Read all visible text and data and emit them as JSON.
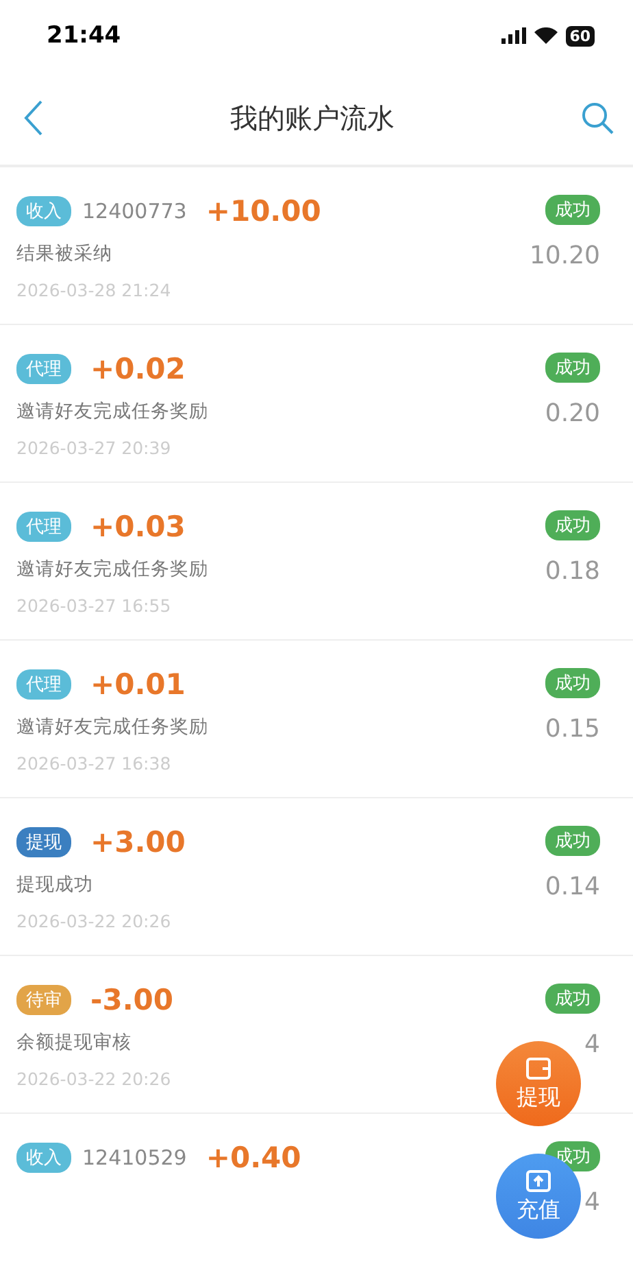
{
  "status_bar": {
    "time": "21:44",
    "battery": "60"
  },
  "nav": {
    "title": "我的账户流水"
  },
  "records": [
    {
      "tag": "收入",
      "color": "#5bbcd8",
      "order": "12400773",
      "amount": "+10.00",
      "status": "成功",
      "description": "结果被采纳",
      "balance": "10.20",
      "date": "2026-03-28 21:24"
    },
    {
      "tag": "代理",
      "color": "#5bbcd8",
      "amount": "+0.02",
      "status": "成功",
      "description": "邀请好友完成任务奖励",
      "balance": "0.20",
      "date": "2026-03-27 20:39"
    },
    {
      "tag": "代理",
      "color": "#5bbcd8",
      "amount": "+0.03",
      "status": "成功",
      "description": "邀请好友完成任务奖励",
      "balance": "0.18",
      "date": "2026-03-27 16:55"
    },
    {
      "tag": "代理",
      "color": "#5bbcd8",
      "amount": "+0.01",
      "status": "成功",
      "description": "邀请好友完成任务奖励",
      "balance": "0.15",
      "date": "2026-03-27 16:38"
    },
    {
      "tag": "提现",
      "color": "#3b7fc0",
      "amount": "+3.00",
      "status": "成功",
      "description": "提现成功",
      "balance": "0.14",
      "date": "2026-03-22 20:26"
    },
    {
      "tag": "待审",
      "color": "#e2a448",
      "amount": "-3.00",
      "status": "成功",
      "description": "余额提现审核",
      "balance": "4",
      "date": "2026-03-22 20:26"
    },
    {
      "tag": "收入",
      "color": "#5bbcd8",
      "order": "12410529",
      "amount": "+0.40",
      "status": "成功",
      "balance": "4"
    }
  ],
  "fabs": [
    {
      "kind": "withdraw",
      "label": "提现"
    },
    {
      "kind": "recharge",
      "label": "充值"
    }
  ]
}
